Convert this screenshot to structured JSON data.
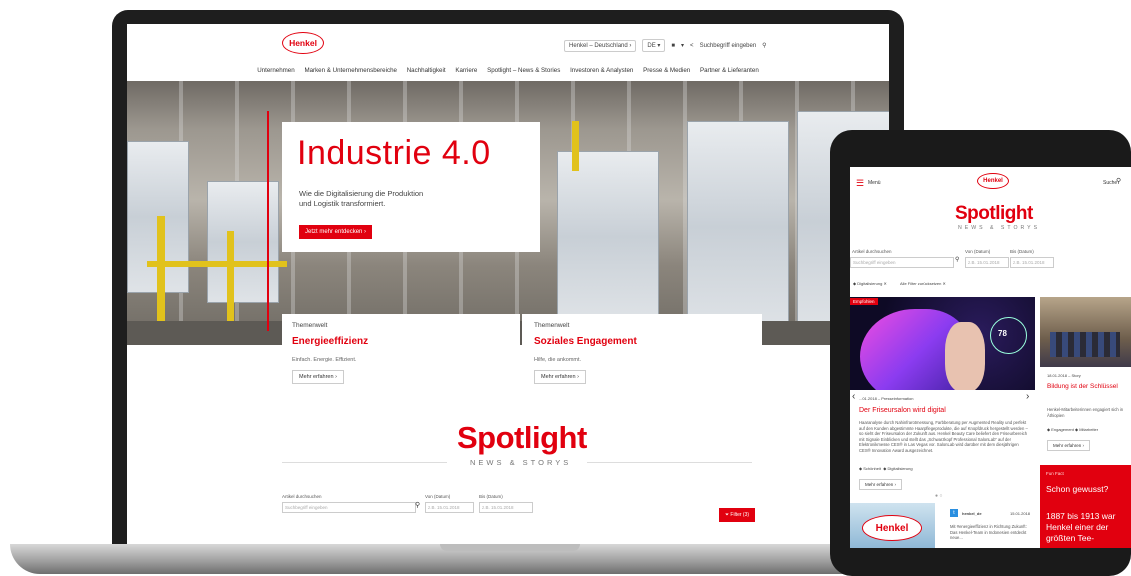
{
  "laptop": {
    "logo": "Henkel",
    "country": "Henkel – Deutschland",
    "language": "DE",
    "search_placeholder": "Suchbegriff eingeben",
    "nav": [
      "Unternehmen",
      "Marken & Unternehmensbereiche",
      "Nachhaltigkeit",
      "Karriere",
      "Spotlight – News & Stories",
      "Investoren & Analysten",
      "Presse & Medien",
      "Partner & Lieferanten"
    ],
    "hero": {
      "title": "Industrie 4.0",
      "subtitle_line1": "Wie die Digitalisierung die Produktion",
      "subtitle_line2": "und Logistik transformiert.",
      "button": "Jetzt mehr entdecken"
    },
    "cards": [
      {
        "kicker": "Themenwelt",
        "title": "Energieeffizienz",
        "sub": "Einfach. Energie. Effizient.",
        "button": "Mehr erfahren"
      },
      {
        "kicker": "Themenwelt",
        "title": "Soziales Engagement",
        "sub": "Hilfe, die ankommt.",
        "button": "Mehr erfahren"
      }
    ],
    "spotlight": {
      "title": "Spotlight",
      "subtitle": "NEWS & STORYS"
    },
    "filters": {
      "article_label": "Artikel durchsuchen",
      "article_placeholder": "Suchbegriff eingeben",
      "from_label": "Von (Datum)",
      "from_placeholder": "z.B. 15.01.2018",
      "to_label": "Bis (Datum)",
      "to_placeholder": "z.B. 15.01.2018",
      "filter_button": "Filter (3)"
    }
  },
  "tablet": {
    "menu_label": "Menü",
    "logo": "Henkel",
    "search_label": "Suche",
    "spotlight": {
      "title": "Spotlight",
      "subtitle": "NEWS & STORYS"
    },
    "filters": {
      "article_label": "Artikel durchsuchen",
      "article_placeholder": "Suchbegriff eingeben",
      "from_label": "Von (Datum)",
      "from_placeholder": "z.B. 15.01.2018",
      "to_label": "Bis (Datum)",
      "to_placeholder": "z.B. 15.01.2018"
    },
    "active_filter": "Digitalisierung",
    "reset_filters": "Alle Filter zurücksetzen",
    "feature": {
      "badge": "Empfohlen",
      "kicker": "...01.2018 – Presseinformation",
      "title": "Der Friseursalon wird digital",
      "body": "Haaranalyse durch Nahinfrarotmessung, Farbberatung per Augmented Reality und perfekt auf den Kunden abgestimmte Haarpflegeprodukte, die auf Knopfdruck hergestellt werden – so sieht der Friseursalon der Zukunft aus. Henkel Beauty Care beliefert den Friseurbereich mit Signale Einblicken und stellt das „Schwarzkopf Professional SalonLab“ auf der Elektronikmesse CES® in Las Vegas vor. SalonLab wird darüber mit dem diesjährigen CES® Innovation Award ausgezeichnet.",
      "tags": [
        "Schönheit",
        "Digitalisierung"
      ],
      "button": "Mehr erfahren",
      "image_overlay": "78"
    },
    "side_story": {
      "kicker": "18.01.2018 – Story",
      "title": "Bildung ist der Schlüssel",
      "body": "Henkel-Mitarbeiterinnen engagiert sich in Äthiopien",
      "tags": [
        "Engagement",
        "Mitarbeiter"
      ],
      "button": "Mehr erfahren"
    },
    "tweet": {
      "handle": "henkel_de",
      "date": "15.01.2018",
      "body": "Mit #energieeffizienz in Richtung Zukunft: Das Henkel-Team in Indonesien entdeckt neue..."
    },
    "fact": {
      "kicker": "Fun Fact",
      "title": "Schon gewusst?",
      "body": "1887 bis 1913 war Henkel einer der größten Tee-"
    }
  }
}
